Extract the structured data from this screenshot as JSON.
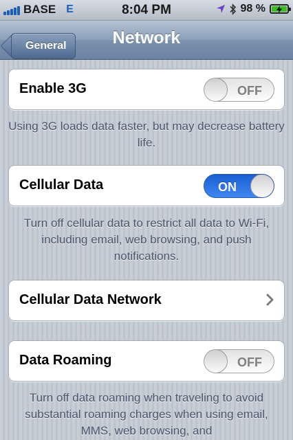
{
  "status_bar": {
    "carrier": "BASE",
    "network_type": "E",
    "time": "8:04 PM",
    "battery": "98 %",
    "signal_bars": 5
  },
  "nav": {
    "back_label": "General",
    "title": "Network"
  },
  "settings": {
    "enable_3g": {
      "label": "Enable 3G",
      "state": "OFF"
    },
    "enable_3g_footer": "Using 3G loads data faster, but may decrease battery life.",
    "cellular_data": {
      "label": "Cellular Data",
      "state": "ON"
    },
    "cellular_data_footer": "Turn off cellular data to restrict all data to Wi-Fi, including email, web browsing, and push notifications.",
    "cellular_data_network": {
      "label": "Cellular Data Network"
    },
    "data_roaming": {
      "label": "Data Roaming",
      "state": "OFF"
    },
    "data_roaming_footer": "Turn off data roaming when traveling to avoid substantial roaming charges when using email, MMS, web browsing, and"
  },
  "colors": {
    "accent_blue": "#1b5fb8",
    "switch_on": "#2f78e8",
    "battery_green": "#3cbd1f",
    "footer_text": "#4c566c"
  },
  "icons": {
    "location": "location-arrow-icon",
    "bluetooth": "bluetooth-icon",
    "battery": "battery-charging-icon",
    "chevron": "chevron-right-icon"
  }
}
